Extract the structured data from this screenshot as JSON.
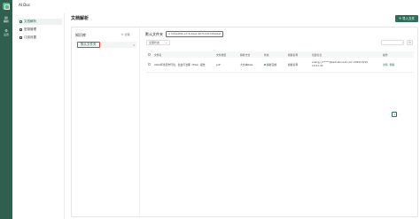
{
  "app": {
    "title": "AI Doc"
  },
  "rail": {
    "items": [
      {
        "label": "解析",
        "icon": "document-icon",
        "glyph": "▤"
      },
      {
        "label": "设置",
        "icon": "settings-icon",
        "glyph": "⚙"
      }
    ]
  },
  "nav": {
    "items": [
      {
        "label": "文档解析",
        "icon": "file-icon"
      },
      {
        "label": "密钥管理",
        "icon": "key-icon"
      },
      {
        "label": "订阅设置",
        "icon": "subscription-icon"
      }
    ]
  },
  "page": {
    "title": "文档解析",
    "import_label": "导入文件",
    "import_glyph": "+"
  },
  "kb": {
    "heading": "知识库",
    "manage_label": "管理",
    "manage_glyph": "✎",
    "item_name": "默认文件夹",
    "item_count": "1"
  },
  "files": {
    "title": "默认文件夹",
    "id_text": "b0be4f4b-e7c6-4ee1-9b7f-1d03d3a6bef",
    "id_glyph": "⊕",
    "filter_label": "全部状态",
    "filter_glyph": "⌄",
    "search_placeholder": "",
    "search_glyph": "⌕",
    "refresh_glyph": "↻",
    "columns": [
      "文件名",
      "文件类型",
      "解析方式",
      "状态",
      "模板名称",
      "创建信息",
      "操作"
    ],
    "rows": [
      {
        "name": "2024年重庆市环境、社会与治理（ESG）报告",
        "type": "pdf",
        "method": "大文本RAG",
        "status": "解析完成",
        "template": "模板名称",
        "created": "energy_z*****@test.abound.com 2024/10/15 13:51:34",
        "ops": [
          "详情",
          "删除"
        ]
      }
    ]
  },
  "pager": {
    "prev": "‹",
    "current": "1",
    "next": "›"
  }
}
